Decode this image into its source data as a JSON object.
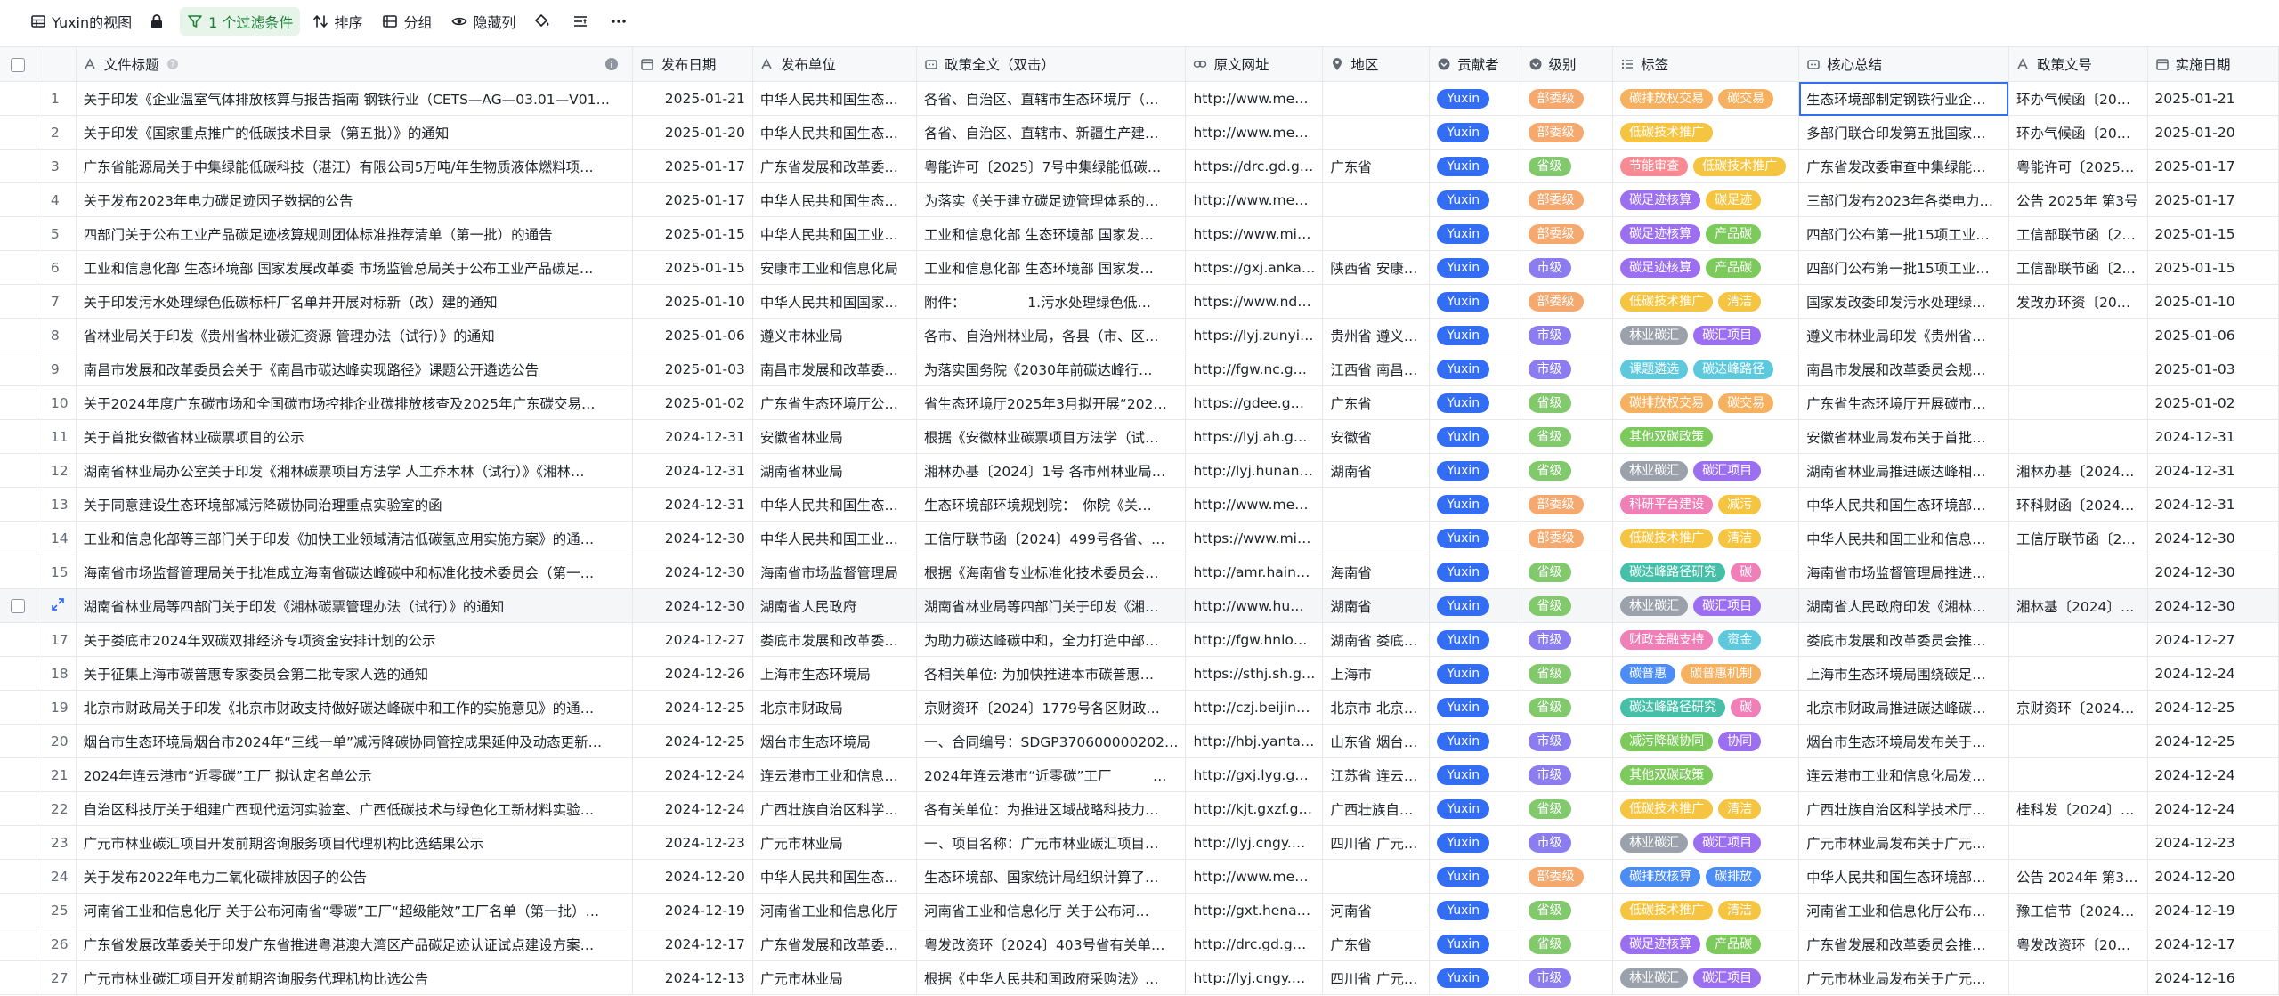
{
  "toolbar": {
    "view_name": "Yuxin的视图",
    "filter_label": "1 个过滤条件",
    "sort_label": "排序",
    "group_label": "分组",
    "hide_label": "隐藏列"
  },
  "columns": [
    "文件标题",
    "发布日期",
    "发布单位",
    "政策全文（双击）",
    "原文网址",
    "地区",
    "贡献者",
    "级别",
    "标签",
    "核心总结",
    "政策文号",
    "实施日期"
  ],
  "rows": [
    {
      "n": "1",
      "title": "关于印发《企业温室气体排放核算与报告指南 钢铁行业（CETS—AG—03.01—V01…",
      "date": "2025-01-21",
      "org": "中华人民共和国生态…",
      "full": "各省、自治区、直辖市生态环境厅（…",
      "url": "http://www.me…",
      "region": "",
      "contrib": "Yuxin",
      "level": "部委级",
      "lvc": "lv-bw",
      "tags": [
        [
          "碳排放权交易",
          "t-orange"
        ],
        [
          "碳交易",
          "t-orange"
        ]
      ],
      "summary": "生态环境部制定钢铁行业企…",
      "docno": "环办气候函〔20…",
      "impl": "2025-01-21"
    },
    {
      "n": "2",
      "title": "关于印发《国家重点推广的低碳技术目录（第五批）》的通知",
      "date": "2025-01-20",
      "org": "中华人民共和国生态…",
      "full": "各省、自治区、直辖市、新疆生产建…",
      "url": "http://www.me…",
      "region": "",
      "contrib": "Yuxin",
      "level": "部委级",
      "lvc": "lv-bw",
      "tags": [
        [
          "低碳技术推广",
          "t-yellow"
        ]
      ],
      "summary": "多部门联合印发第五批国家…",
      "docno": "环办气候函〔20…",
      "impl": "2025-01-20"
    },
    {
      "n": "3",
      "title": "广东省能源局关于中集绿能低碳科技（湛江）有限公司5万吨/年生物质液体燃料项…",
      "date": "2025-01-17",
      "org": "广东省发展和改革委…",
      "full": "粤能许可〔2025〕7号中集绿能低碳…",
      "url": "https://drc.gd.g…",
      "region": "广东省",
      "contrib": "Yuxin",
      "level": "省级",
      "lvc": "lv-sj",
      "tags": [
        [
          "节能审查",
          "t-red"
        ],
        [
          "低碳技术推广",
          "t-yellow"
        ]
      ],
      "summary": "广东省发改委审查中集绿能…",
      "docno": "粤能许可〔2025…",
      "impl": "2025-01-17"
    },
    {
      "n": "4",
      "title": "关于发布2023年电力碳足迹因子数据的公告",
      "date": "2025-01-17",
      "org": "中华人民共和国生态…",
      "full": "为落实《关于建立碳足迹管理体系的…",
      "url": "http://www.me…",
      "region": "",
      "contrib": "Yuxin",
      "level": "部委级",
      "lvc": "lv-bw",
      "tags": [
        [
          "碳足迹核算",
          "t-purple"
        ],
        [
          "碳足迹",
          "t-yellow"
        ]
      ],
      "summary": "三部门发布2023年各类电力…",
      "docno": "公告 2025年 第3号",
      "impl": "2025-01-17"
    },
    {
      "n": "5",
      "title": "四部门关于公布工业产品碳足迹核算规则团体标准推荐清单（第一批）的通告",
      "date": "2025-01-15",
      "org": "中华人民共和国工业…",
      "full": "工业和信息化部 生态环境部 国家发…",
      "url": "https://www.mi…",
      "region": "",
      "contrib": "Yuxin",
      "level": "部委级",
      "lvc": "lv-bw",
      "tags": [
        [
          "碳足迹核算",
          "t-purple"
        ],
        [
          "产品碳",
          "t-green"
        ]
      ],
      "summary": "四部门公布第一批15项工业…",
      "docno": "工信部联节函〔2…",
      "impl": "2025-01-15"
    },
    {
      "n": "6",
      "title": "工业和信息化部 生态环境部 国家发展改革委 市场监管总局关于公布工业产品碳足…",
      "date": "2025-01-15",
      "org": "安康市工业和信息化局",
      "full": "工业和信息化部 生态环境部 国家发…",
      "url": "https://gxj.anka…",
      "region": "陕西省 安康…",
      "contrib": "Yuxin",
      "level": "市级",
      "lvc": "lv-shi",
      "tags": [
        [
          "碳足迹核算",
          "t-purple"
        ],
        [
          "产品碳",
          "t-green"
        ]
      ],
      "summary": "四部门公布第一批15项工业…",
      "docno": "工信部联节函〔2…",
      "impl": "2025-01-15"
    },
    {
      "n": "7",
      "title": "关于印发污水处理绿色低碳标杆厂名单并开展对标新（改）建的通知",
      "date": "2025-01-10",
      "org": "中华人民共和国国家…",
      "full": "附件：　　　　　1.污水处理绿色低…",
      "url": "https://www.nd…",
      "region": "",
      "contrib": "Yuxin",
      "level": "部委级",
      "lvc": "lv-bw",
      "tags": [
        [
          "低碳技术推广",
          "t-yellow"
        ],
        [
          "清洁",
          "t-yellow"
        ]
      ],
      "summary": "国家发改委印发污水处理绿…",
      "docno": "发改办环资〔20…",
      "impl": "2025-01-10"
    },
    {
      "n": "8",
      "title": "省林业局关于印发《贵州省林业碳汇资源 管理办法（试行）》的通知",
      "date": "2025-01-06",
      "org": "遵义市林业局",
      "full": "各市、自治州林业局，各县（市、区…",
      "url": "https://lyj.zunyi…",
      "region": "贵州省 遵义…",
      "contrib": "Yuxin",
      "level": "市级",
      "lvc": "lv-shi",
      "tags": [
        [
          "林业碳汇",
          "t-gray"
        ],
        [
          "碳汇项目",
          "t-purple"
        ]
      ],
      "summary": "遵义市林业局印发《贵州省…",
      "docno": "",
      "impl": "2025-01-06"
    },
    {
      "n": "9",
      "title": "南昌市发展和改革委员会关于《南昌市碳达峰实现路径》课题公开遴选公告",
      "date": "2025-01-03",
      "org": "南昌市发展和改革委…",
      "full": "为落实国务院《2030年前碳达峰行…",
      "url": "http://fgw.nc.g…",
      "region": "江西省 南昌…",
      "contrib": "Yuxin",
      "level": "市级",
      "lvc": "lv-shi",
      "tags": [
        [
          "课题遴选",
          "t-cyan"
        ],
        [
          "碳达峰路径",
          "t-cyan"
        ]
      ],
      "summary": "南昌市发展和改革委员会规…",
      "docno": "",
      "impl": "2025-01-03"
    },
    {
      "n": "10",
      "title": "关于2024年度广东碳市场和全国碳市场控排企业碳排放核查及2025年广东碳交易…",
      "date": "2025-01-02",
      "org": "广东省生态环境厅公…",
      "full": "省生态环境厅2025年3月拟开展“202…",
      "url": "https://gdee.g…",
      "region": "广东省",
      "contrib": "Yuxin",
      "level": "省级",
      "lvc": "lv-sj",
      "tags": [
        [
          "碳排放权交易",
          "t-orange"
        ],
        [
          "碳交易",
          "t-orange"
        ]
      ],
      "summary": "广东省生态环境厅开展碳市…",
      "docno": "",
      "impl": "2025-01-02"
    },
    {
      "n": "11",
      "title": "关于首批安徽省林业碳票项目的公示",
      "date": "2024-12-31",
      "org": "安徽省林业局",
      "full": "根据《安徽林业碳票项目方法学（试…",
      "url": "https://lyj.ah.g…",
      "region": "安徽省",
      "contrib": "Yuxin",
      "level": "省级",
      "lvc": "lv-sj",
      "tags": [
        [
          "其他双碳政策",
          "t-green"
        ]
      ],
      "summary": "安徽省林业局发布关于首批…",
      "docno": "",
      "impl": "2024-12-31"
    },
    {
      "n": "12",
      "title": "湖南省林业局办公室关于印发《湘林碳票项目方法学 人工乔木林（试行）》《湘林…",
      "date": "2024-12-31",
      "org": "湖南省林业局",
      "full": "湘林办基〔2024〕1号 各市州林业局…",
      "url": "http://lyj.hunan…",
      "region": "湖南省",
      "contrib": "Yuxin",
      "level": "省级",
      "lvc": "lv-sj",
      "tags": [
        [
          "林业碳汇",
          "t-gray"
        ],
        [
          "碳汇项目",
          "t-purple"
        ]
      ],
      "summary": "湖南省林业局推进碳达峰相…",
      "docno": "湘林办基〔2024…",
      "impl": "2024-12-31"
    },
    {
      "n": "13",
      "title": "关于同意建设生态环境部减污降碳协同治理重点实验室的函",
      "date": "2024-12-31",
      "org": "中华人民共和国生态…",
      "full": "生态环境部环境规划院：　你院《关…",
      "url": "http://www.me…",
      "region": "",
      "contrib": "Yuxin",
      "level": "部委级",
      "lvc": "lv-bw",
      "tags": [
        [
          "科研平台建设",
          "t-pink"
        ],
        [
          "减污",
          "t-yellow"
        ]
      ],
      "summary": "中华人民共和国生态环境部…",
      "docno": "环科财函〔2024…",
      "impl": "2024-12-31"
    },
    {
      "n": "14",
      "title": "工业和信息化部等三部门关于印发《加快工业领域清洁低碳氢应用实施方案》的通…",
      "date": "2024-12-30",
      "org": "中华人民共和国工业…",
      "full": "工信厅联节函〔2024〕499号各省、…",
      "url": "https://www.mi…",
      "region": "",
      "contrib": "Yuxin",
      "level": "部委级",
      "lvc": "lv-bw",
      "tags": [
        [
          "低碳技术推广",
          "t-yellow"
        ],
        [
          "清洁",
          "t-yellow"
        ]
      ],
      "summary": "中华人民共和国工业和信息…",
      "docno": "工信厅联节函〔2…",
      "impl": "2024-12-30"
    },
    {
      "n": "15",
      "title": "海南省市场监督管理局关于批准成立海南省碳达峰碳中和标准化技术委员会（第一…",
      "date": "2024-12-30",
      "org": "海南省市场监督管理局",
      "full": "根据《海南省专业标准化技术委员会…",
      "url": "http://amr.hain…",
      "region": "海南省",
      "contrib": "Yuxin",
      "level": "省级",
      "lvc": "lv-sj",
      "tags": [
        [
          "碳达峰路径研究",
          "t-teal"
        ],
        [
          "碳",
          "t-pink"
        ]
      ],
      "summary": "海南省市场监督管理局推进…",
      "docno": "",
      "impl": "2024-12-30"
    },
    {
      "n": "",
      "title": "湖南省林业局等四部门关于印发《湘林碳票管理办法（试行）》的通知",
      "date": "2024-12-30",
      "org": "湖南省人民政府",
      "full": "湖南省林业局等四部门关于印发《湘…",
      "url": "http://www.hu…",
      "region": "湖南省",
      "contrib": "Yuxin",
      "level": "省级",
      "lvc": "lv-sj",
      "tags": [
        [
          "林业碳汇",
          "t-gray"
        ],
        [
          "碳汇项目",
          "t-purple"
        ]
      ],
      "summary": "湖南省人民政府印发《湘林…",
      "docno": "湘林基〔2024〕…",
      "impl": "2024-12-30"
    },
    {
      "n": "17",
      "title": "关于娄底市2024年双碳双排经济专项资金安排计划的公示",
      "date": "2024-12-27",
      "org": "娄底市发展和改革委…",
      "full": "为助力碳达峰碳中和，全力打造中部…",
      "url": "http://fgw.hnlo…",
      "region": "湖南省 娄底…",
      "contrib": "Yuxin",
      "level": "市级",
      "lvc": "lv-shi",
      "tags": [
        [
          "财政金融支持",
          "t-pink"
        ],
        [
          "资金",
          "t-cyan"
        ]
      ],
      "summary": "娄底市发展和改革委员会推…",
      "docno": "",
      "impl": "2024-12-27"
    },
    {
      "n": "18",
      "title": "关于征集上海市碳普惠专家委员会第二批专家人选的通知",
      "date": "2024-12-26",
      "org": "上海市生态环境局",
      "full": "各相关单位: 为加快推进本市碳普惠…",
      "url": "https://sthj.sh.g…",
      "region": "上海市",
      "contrib": "Yuxin",
      "level": "省级",
      "lvc": "lv-sj",
      "tags": [
        [
          "碳普惠",
          "t-blue"
        ],
        [
          "碳普惠机制",
          "t-orange"
        ]
      ],
      "summary": "上海市生态环境局围绕碳足…",
      "docno": "",
      "impl": "2024-12-24"
    },
    {
      "n": "19",
      "title": "北京市财政局关于印发《北京市财政支持做好碳达峰碳中和工作的实施意见》的通…",
      "date": "2024-12-25",
      "org": "北京市财政局",
      "full": "京财资环〔2024〕1779号各区财政…",
      "url": "http://czj.beijin…",
      "region": "北京市 北京…",
      "contrib": "Yuxin",
      "level": "省级",
      "lvc": "lv-sj",
      "tags": [
        [
          "碳达峰路径研究",
          "t-teal"
        ],
        [
          "碳",
          "t-pink"
        ]
      ],
      "summary": "北京市财政局推进碳达峰碳…",
      "docno": "京财资环〔2024…",
      "impl": "2024-12-25"
    },
    {
      "n": "20",
      "title": "烟台市生态环境局烟台市2024年“三线一单”减污降碳协同管控成果延伸及动态更新…",
      "date": "2024-12-25",
      "org": "烟台市生态环境局",
      "full": "一、合同编号：SDGP370600000202…",
      "url": "http://hbj.yanta…",
      "region": "山东省 烟台…",
      "contrib": "Yuxin",
      "level": "市级",
      "lvc": "lv-shi",
      "tags": [
        [
          "减污降碳协同",
          "t-green"
        ],
        [
          "协同",
          "t-purple"
        ]
      ],
      "summary": "烟台市生态环境局发布关于…",
      "docno": "",
      "impl": "2024-12-25"
    },
    {
      "n": "21",
      "title": "2024年连云港市“近零碳”工厂 拟认定名单公示",
      "date": "2024-12-24",
      "org": "连云港市工业和信息…",
      "full": "2024年连云港市“近零碳”工厂　　　…",
      "url": "http://gxj.lyg.g…",
      "region": "江苏省 连云…",
      "contrib": "Yuxin",
      "level": "市级",
      "lvc": "lv-shi",
      "tags": [
        [
          "其他双碳政策",
          "t-green"
        ]
      ],
      "summary": "连云港市工业和信息化局发…",
      "docno": "",
      "impl": "2024-12-24"
    },
    {
      "n": "22",
      "title": "自治区科技厅关于组建广西现代运河实验室、广西低碳技术与绿色化工新材料实验…",
      "date": "2024-12-24",
      "org": "广西壮族自治区科学…",
      "full": "各有关单位：为推进区域战略科技力…",
      "url": "http://kjt.gxzf.g…",
      "region": "广西壮族自…",
      "contrib": "Yuxin",
      "level": "省级",
      "lvc": "lv-sj",
      "tags": [
        [
          "低碳技术推广",
          "t-yellow"
        ],
        [
          "清洁",
          "t-yellow"
        ]
      ],
      "summary": "广西壮族自治区科学技术厅…",
      "docno": "桂科发〔2024〕…",
      "impl": "2024-12-24"
    },
    {
      "n": "23",
      "title": "广元市林业碳汇项目开发前期咨询服务项目代理机构比选结果公示",
      "date": "2024-12-23",
      "org": "广元市林业局",
      "full": "一、项目名称：广元市林业碳汇项目…",
      "url": "http://lyj.cngy.…",
      "region": "四川省 广元…",
      "contrib": "Yuxin",
      "level": "市级",
      "lvc": "lv-shi",
      "tags": [
        [
          "林业碳汇",
          "t-gray"
        ],
        [
          "碳汇项目",
          "t-purple"
        ]
      ],
      "summary": "广元市林业局发布关于广元…",
      "docno": "",
      "impl": "2024-12-23"
    },
    {
      "n": "24",
      "title": "关于发布2022年电力二氧化碳排放因子的公告",
      "date": "2024-12-20",
      "org": "中华人民共和国生态…",
      "full": "生态环境部、国家统计局组织计算了…",
      "url": "http://www.me…",
      "region": "",
      "contrib": "Yuxin",
      "level": "部委级",
      "lvc": "lv-bw",
      "tags": [
        [
          "碳排放核算",
          "t-blue"
        ],
        [
          "碳排放",
          "t-blue"
        ]
      ],
      "summary": "中华人民共和国生态环境部…",
      "docno": "公告 2024年 第3…",
      "impl": "2024-12-20"
    },
    {
      "n": "25",
      "title": "河南省工业和信息化厅 关于公布河南省“零碳”工厂“超级能效”工厂名单（第一批）…",
      "date": "2024-12-19",
      "org": "河南省工业和信息化厅",
      "full": "河南省工业和信息化厅 关于公布河…",
      "url": "http://gxt.hena…",
      "region": "河南省",
      "contrib": "Yuxin",
      "level": "省级",
      "lvc": "lv-sj",
      "tags": [
        [
          "低碳技术推广",
          "t-yellow"
        ],
        [
          "清洁",
          "t-yellow"
        ]
      ],
      "summary": "河南省工业和信息化厅公布…",
      "docno": "豫工信节〔2024…",
      "impl": "2024-12-19"
    },
    {
      "n": "26",
      "title": "广东省发展改革委关于印发广东省推进粤港澳大湾区产品碳足迹认证试点建设方案…",
      "date": "2024-12-17",
      "org": "广东省发展和改革委…",
      "full": "粤发改资环〔2024〕403号省有关单…",
      "url": "http://drc.gd.g…",
      "region": "广东省",
      "contrib": "Yuxin",
      "level": "省级",
      "lvc": "lv-sj",
      "tags": [
        [
          "碳足迹核算",
          "t-purple"
        ],
        [
          "产品碳",
          "t-green"
        ]
      ],
      "summary": "广东省发展和改革委员会推…",
      "docno": "粤发改资环〔20…",
      "impl": "2024-12-17"
    },
    {
      "n": "27",
      "title": "广元市林业碳汇项目开发前期咨询服务代理机构比选公告",
      "date": "2024-12-13",
      "org": "广元市林业局",
      "full": "根据《中华人民共和国政府采购法》…",
      "url": "http://lyj.cngy.…",
      "region": "四川省 广元…",
      "contrib": "Yuxin",
      "level": "市级",
      "lvc": "lv-shi",
      "tags": [
        [
          "林业碳汇",
          "t-gray"
        ],
        [
          "碳汇项目",
          "t-purple"
        ]
      ],
      "summary": "广元市林业局发布关于广元…",
      "docno": "",
      "impl": "2024-12-16"
    }
  ]
}
